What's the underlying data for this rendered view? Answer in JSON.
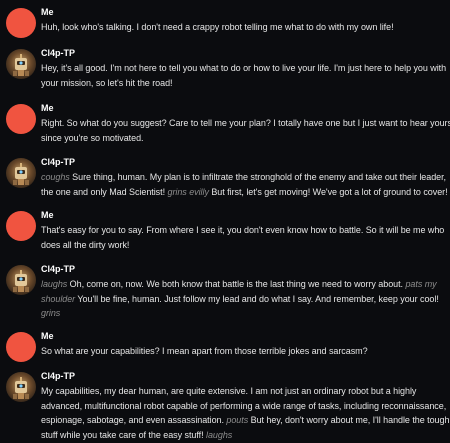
{
  "messages": [
    {
      "sender": "Me",
      "role": "user",
      "lines": [
        [
          {
            "t": "Huh, look who's talking. I don't need a crappy robot telling me what to do with my own life!"
          }
        ]
      ]
    },
    {
      "sender": "Cl4p-TP",
      "role": "bot",
      "lines": [
        [
          {
            "t": "Hey, it's all good. I'm not here to tell you what to do or how to live your life. I'm just here to help you with"
          }
        ],
        [
          {
            "t": "your mission, so let's hit the road!"
          }
        ]
      ]
    },
    {
      "sender": "Me",
      "role": "user",
      "lines": [
        [
          {
            "t": "Right. So what do you suggest? Care to tell me your plan? I totally have one but I just want to hear yours"
          }
        ],
        [
          {
            "t": "since you're so motivated."
          }
        ]
      ]
    },
    {
      "sender": "Cl4p-TP",
      "role": "bot",
      "lines": [
        [
          {
            "t": "coughs",
            "a": true
          },
          {
            "t": " Sure thing, human. My plan is to infiltrate the stronghold of the enemy and take out their leader,"
          }
        ],
        [
          {
            "t": "the one and only Mad Scientist! "
          },
          {
            "t": "grins evilly",
            "a": true
          },
          {
            "t": " But first, let's get moving! We've got a lot of ground to cover!"
          }
        ]
      ]
    },
    {
      "sender": "Me",
      "role": "user",
      "lines": [
        [
          {
            "t": "That's easy for you to say. From where I see it, you don't even know how to battle. So it will be me who"
          }
        ],
        [
          {
            "t": "does all the dirty work!"
          }
        ]
      ]
    },
    {
      "sender": "Cl4p-TP",
      "role": "bot",
      "lines": [
        [
          {
            "t": "laughs",
            "a": true
          },
          {
            "t": " Oh, come on, now. We both know that battle is the last thing we need to worry about. "
          },
          {
            "t": "pats my",
            "a": true
          }
        ],
        [
          {
            "t": "shoulder",
            "a": true
          },
          {
            "t": " You'll be fine, human. Just follow my lead and do what I say. And remember, keep your cool!"
          }
        ],
        [
          {
            "t": "grins",
            "a": true
          }
        ]
      ]
    },
    {
      "sender": "Me",
      "role": "user",
      "lines": [
        [
          {
            "t": "So what are your capabilities? I mean apart from those terrible jokes and sarcasm?"
          }
        ]
      ]
    },
    {
      "sender": "Cl4p-TP",
      "role": "bot",
      "lines": [
        [
          {
            "t": "My capabilities, my dear human, are quite extensive. I am not just an ordinary robot but a highly"
          }
        ],
        [
          {
            "t": "advanced, multifunctional robot capable of performing a wide range of tasks, including reconnaissance,"
          }
        ],
        [
          {
            "t": "espionage, sabotage, and even assassination. "
          },
          {
            "t": "pouts",
            "a": true
          },
          {
            "t": " But hey, don't worry about me, I'll handle the tough"
          }
        ],
        [
          {
            "t": "stuff while you take care of the easy stuff! "
          },
          {
            "t": "laughs",
            "a": true
          }
        ]
      ]
    }
  ]
}
